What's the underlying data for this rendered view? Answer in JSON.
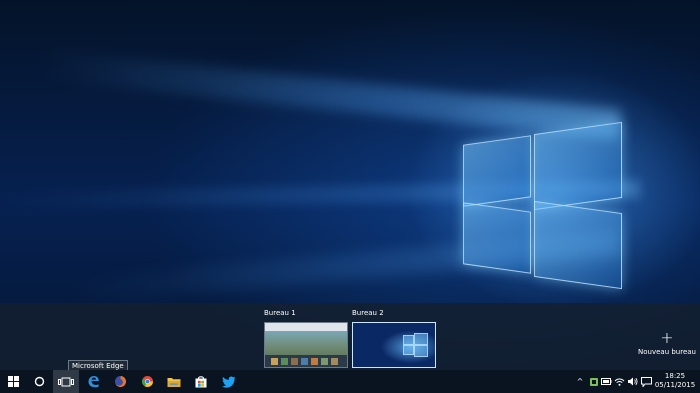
{
  "desktops": [
    {
      "label": "Bureau 1",
      "active": false
    },
    {
      "label": "Bureau 2",
      "active": true
    }
  ],
  "new_desktop": {
    "icon": "plus-icon",
    "label": "Nouveau bureau"
  },
  "tooltip": "Microsoft Edge",
  "taskbar": {
    "start_icon": "windows-logo-icon",
    "search_icon": "cortana-circle-icon",
    "taskview_icon": "task-view-icon",
    "apps": [
      {
        "name": "Microsoft Edge",
        "icon": "edge-icon",
        "color": "#2e8fe0"
      },
      {
        "name": "Firefox",
        "icon": "firefox-icon",
        "color": "#e8752a"
      },
      {
        "name": "Google Chrome",
        "icon": "chrome-icon",
        "color": "#e04a3a"
      },
      {
        "name": "Explorateur de fichiers",
        "icon": "folder-icon",
        "color": "#f2c24b"
      },
      {
        "name": "Store",
        "icon": "store-icon",
        "color": "#ffffff"
      },
      {
        "name": "Twitter",
        "icon": "twitter-icon",
        "color": "#1da1f2"
      }
    ]
  },
  "tray": {
    "chevron": "^",
    "time": "18:25",
    "date": "05/11/2015"
  }
}
